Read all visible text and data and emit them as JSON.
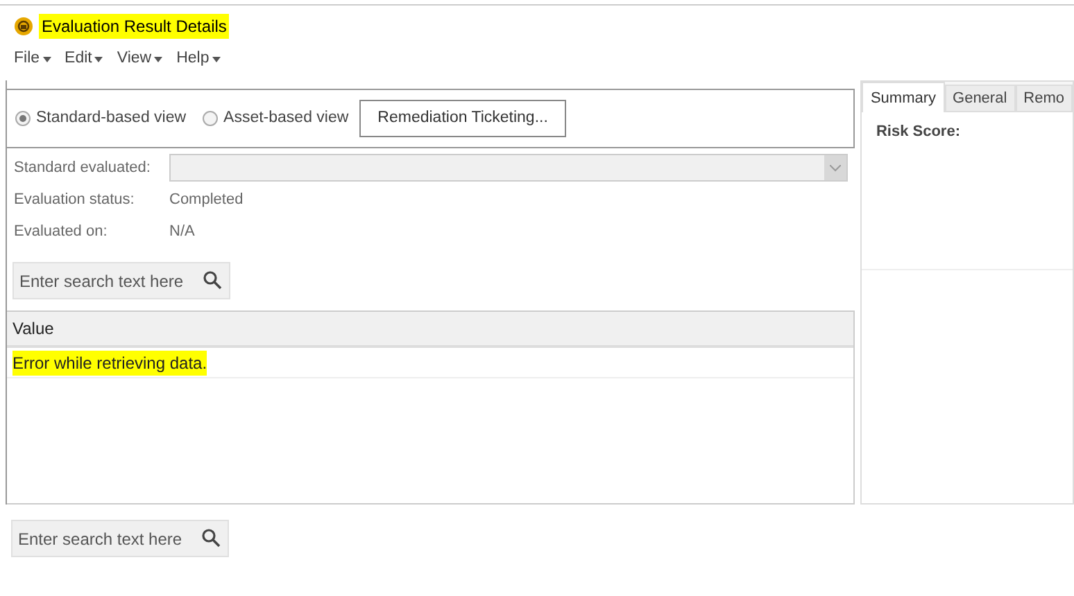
{
  "window": {
    "title": "Evaluation Result Details",
    "title_highlighted": true
  },
  "menu": [
    {
      "label": "File"
    },
    {
      "label": "Edit"
    },
    {
      "label": "View"
    },
    {
      "label": "Help"
    }
  ],
  "view_options": [
    {
      "label": "Standard-based view",
      "selected": true
    },
    {
      "label": "Asset-based view",
      "selected": false
    }
  ],
  "remediation_button": "Remediation Ticketing...",
  "fields": [
    {
      "kind": "dropdown",
      "label": "Standard evaluated:",
      "disabled": true
    },
    {
      "kind": "text",
      "label": "Evaluation status:",
      "value": "Completed"
    },
    {
      "kind": "text",
      "label": "Evaluated on:",
      "value": "N/A"
    }
  ],
  "search_top": {
    "placeholder": "Enter search text here"
  },
  "table": {
    "columns": [
      "Value"
    ],
    "rows": [
      {
        "text": "Error while retrieving data.",
        "highlighted": true
      }
    ]
  },
  "search_bottom": {
    "placeholder": "Enter search text here"
  },
  "side_tabs": [
    {
      "label": "Summary",
      "selected": true
    },
    {
      "label": "General",
      "selected": false
    },
    {
      "label": "Remo",
      "selected": false
    }
  ],
  "summary": {
    "label": "Risk Score:"
  }
}
